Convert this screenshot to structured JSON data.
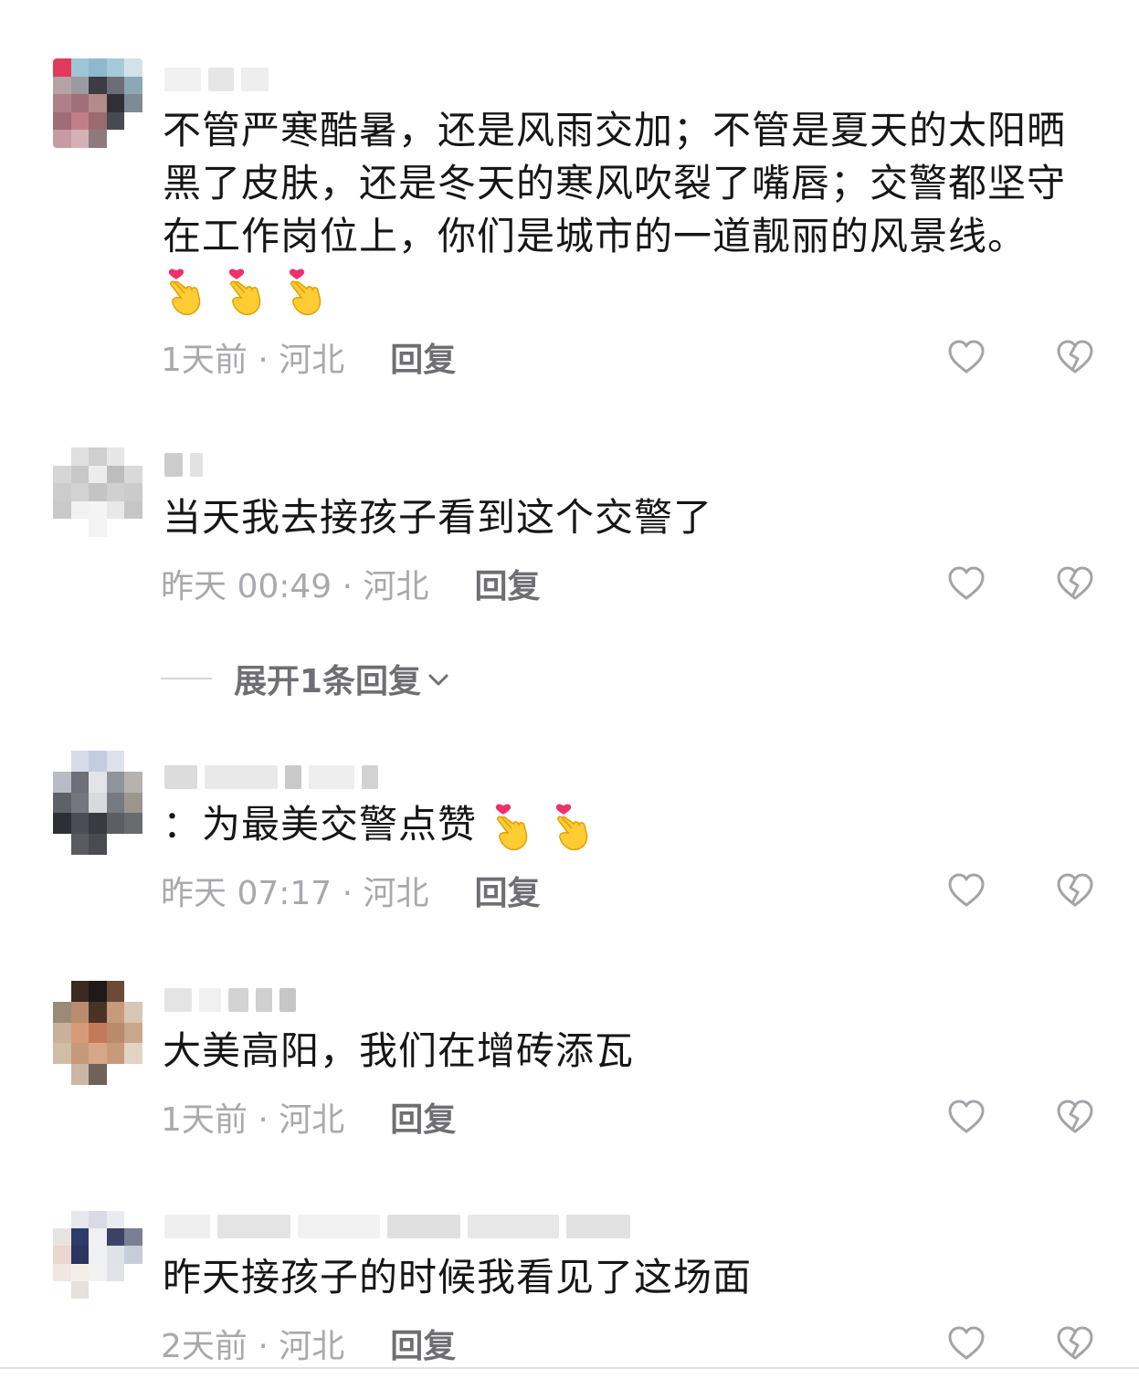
{
  "comments": [
    {
      "text": "不管严寒酷暑，还是风雨交加；不管是夏天的太阳晒黑了皮肤，还是冬天的寒风吹裂了嘴唇；交警都坚守在工作岗位上，你们是城市的一道靓丽的风景线。",
      "emoji_count": 3,
      "emoji_icon": "finger-heart-icon",
      "time": "1天前 · 河北",
      "reply_label": "回复"
    },
    {
      "text": "当天我去接孩子看到这个交警了",
      "time": "昨天 00:49 · 河北",
      "reply_label": "回复",
      "expand_label": "展开1条回复"
    },
    {
      "text": "：为最美交警点赞",
      "emoji_count": 2,
      "emoji_icon": "finger-heart-icon",
      "time": "昨天 07:17 · 河北",
      "reply_label": "回复"
    },
    {
      "text": "大美高阳，我们在增砖添瓦",
      "time": "1天前 · 河北",
      "reply_label": "回复"
    },
    {
      "text": "昨天接孩子的时候我看见了这场面",
      "time": "2天前 · 河北",
      "reply_label": "回复"
    }
  ],
  "icons": {
    "like": "heart-outline-icon",
    "dislike": "broken-heart-icon",
    "expand": "chevron-down-icon"
  },
  "colors": {
    "text": "#161616",
    "meta": "#a9a9ad",
    "reply": "#6e6e73"
  }
}
